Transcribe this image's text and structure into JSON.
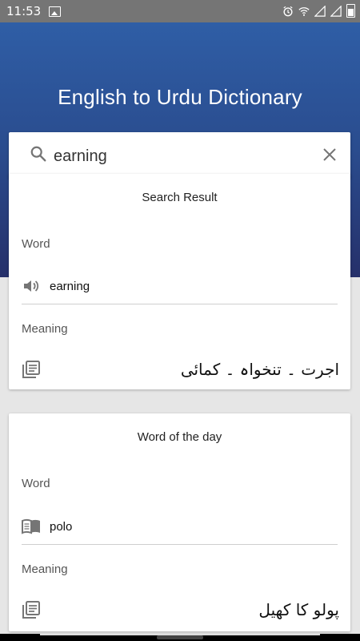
{
  "status_bar": {
    "time": "11:53",
    "icons": [
      "image-icon",
      "alarm-icon",
      "wifi-icon",
      "signal-icon",
      "signal-icon",
      "battery-icon"
    ]
  },
  "header": {
    "title": "English to Urdu Dictionary"
  },
  "search": {
    "value": "earning",
    "placeholder": ""
  },
  "search_result": {
    "title": "Search Result",
    "word_label": "Word",
    "word": "earning",
    "word_icon": "speaker-icon",
    "meaning_label": "Meaning",
    "meaning_icon": "notes-icon",
    "meaning": "اجرت ۔ تنخواہ ۔ کمائی"
  },
  "word_of_day": {
    "title": "Word of the day",
    "word_label": "Word",
    "word": "polo",
    "word_icon": "book-icon",
    "meaning_label": "Meaning",
    "meaning_icon": "notes-icon",
    "meaning": "پولو کا کھیل"
  },
  "colors": {
    "header_top": "#2f5ea6",
    "header_bottom": "#26306a",
    "status_bar": "#757575",
    "background": "#e6e6e6"
  }
}
